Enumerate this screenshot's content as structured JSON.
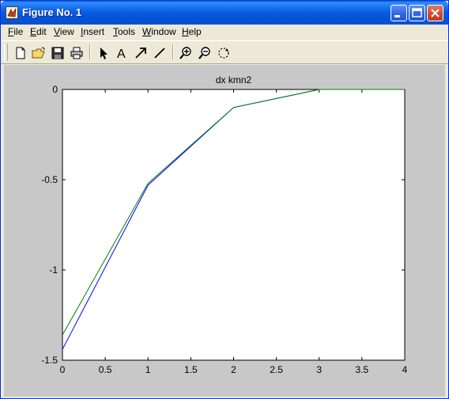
{
  "window": {
    "title": "Figure No. 1",
    "titlebar_color": "#0553d6"
  },
  "menubar": {
    "items": [
      {
        "label_u": "F",
        "label_rest": "ile"
      },
      {
        "label_u": "E",
        "label_rest": "dit"
      },
      {
        "label_u": "V",
        "label_rest": "iew"
      },
      {
        "label_u": "I",
        "label_rest": "nsert"
      },
      {
        "label_u": "T",
        "label_rest": "ools"
      },
      {
        "label_u": "W",
        "label_rest": "indow"
      },
      {
        "label_u": "H",
        "label_rest": "elp"
      }
    ]
  },
  "toolbar": {
    "tools": [
      "new-file-icon",
      "open-folder-icon",
      "save-icon",
      "print-icon",
      "select-arrow-icon",
      "text-icon",
      "arrow-icon",
      "line-icon",
      "zoom-in-icon",
      "zoom-out-icon",
      "rotate-icon"
    ],
    "text_tool_label": "A"
  },
  "chart_data": {
    "type": "line",
    "title": "dx kmn2",
    "xlabel": "",
    "ylabel": "",
    "xlim": [
      0,
      4
    ],
    "ylim": [
      -1.5,
      0
    ],
    "grid": false,
    "x_ticks": [
      "0",
      "0.5",
      "1",
      "1.5",
      "2",
      "2.5",
      "3",
      "3.5",
      "4"
    ],
    "y_ticks": [
      "0",
      "-0.5",
      "-1",
      "-1.5"
    ],
    "series": [
      {
        "color": "#0000ff",
        "x": [
          0,
          1,
          2,
          3,
          4
        ],
        "y": [
          -1.44,
          -0.53,
          -0.1,
          0,
          0
        ]
      },
      {
        "color": "#008000",
        "x": [
          0,
          1,
          2,
          3,
          4
        ],
        "y": [
          -1.36,
          -0.52,
          -0.1,
          0,
          0
        ]
      }
    ],
    "background": "#ffffff",
    "figure_color": "#c8c8c8"
  }
}
